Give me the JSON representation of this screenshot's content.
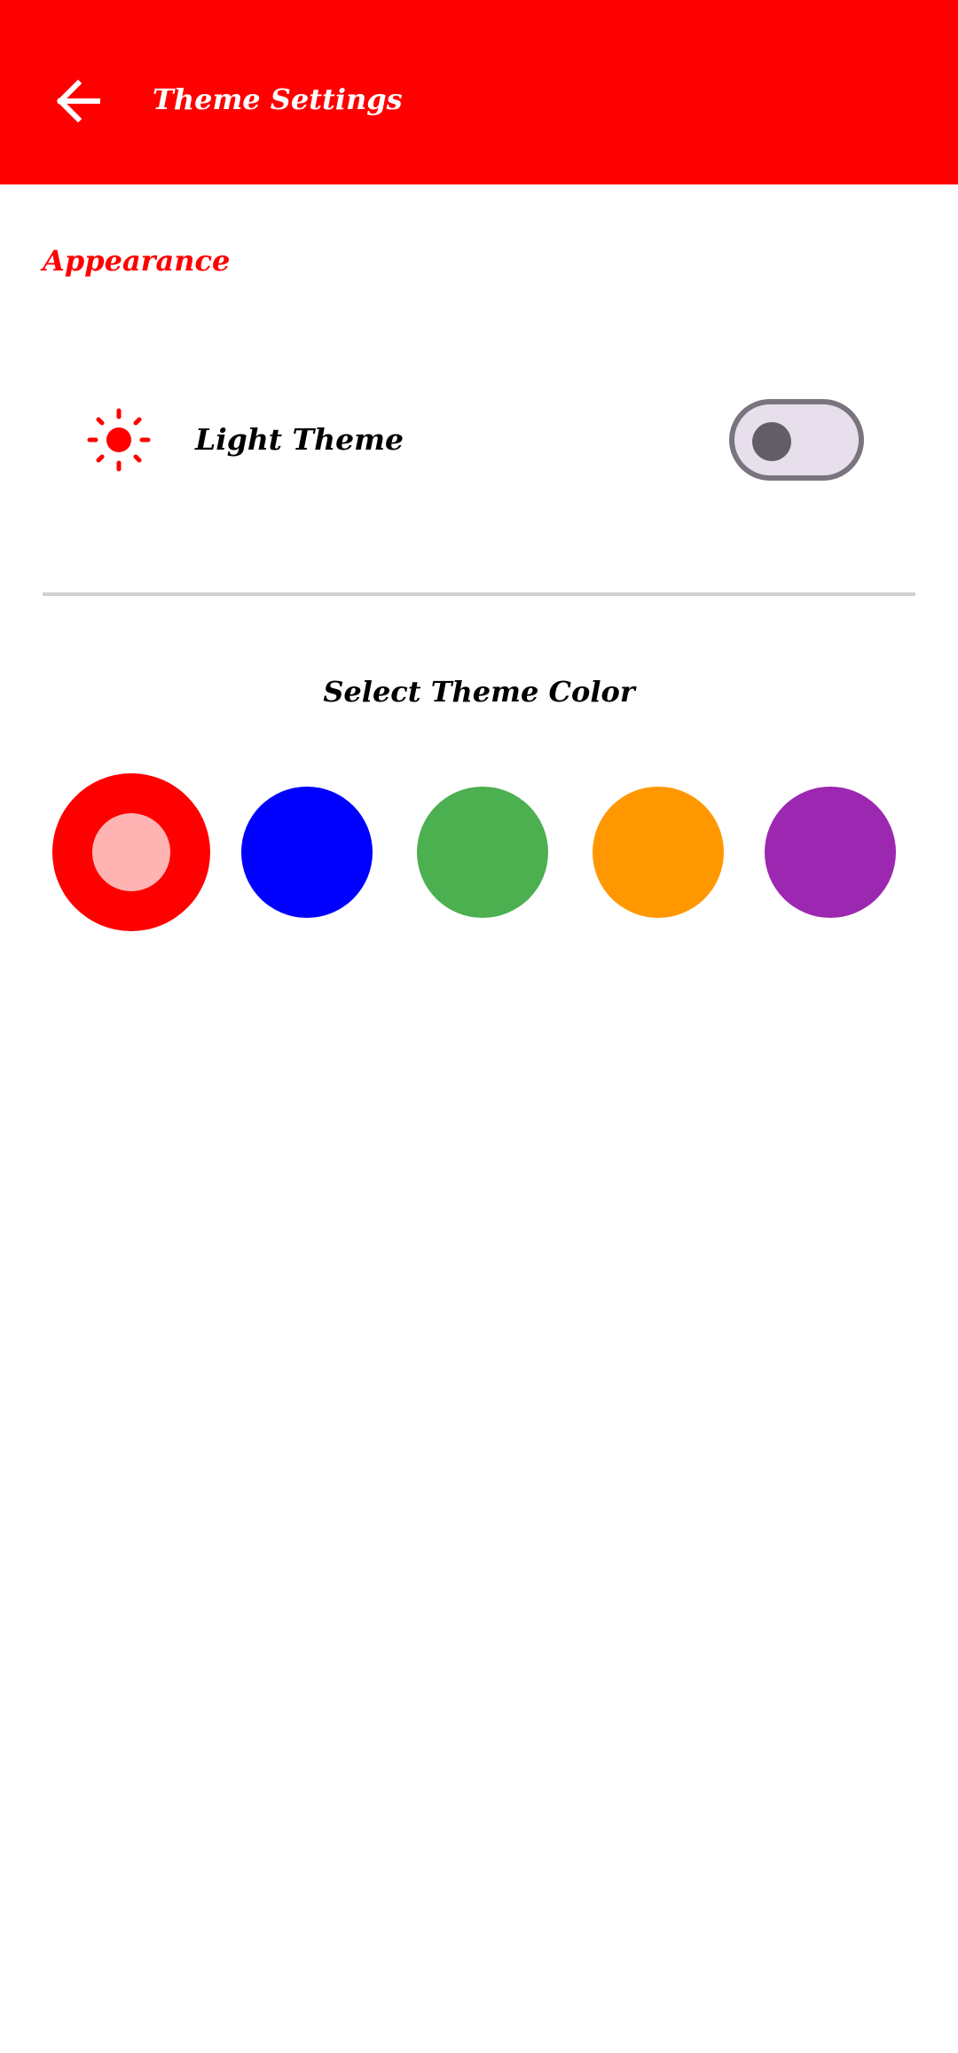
{
  "app_bar": {
    "title": "Theme Settings",
    "back_icon": "arrow-left-icon",
    "background": "#ff0000"
  },
  "appearance": {
    "section_title": "Appearance",
    "theme_row": {
      "icon": "sun-icon",
      "label": "Light Theme",
      "toggle_on": false
    }
  },
  "theme_colors": {
    "heading": "Select Theme Color",
    "swatches": [
      {
        "name": "red",
        "color": "#ff0000",
        "selected": true
      },
      {
        "name": "blue",
        "color": "#0000ff",
        "selected": false
      },
      {
        "name": "green",
        "color": "#4caf50",
        "selected": false
      },
      {
        "name": "orange",
        "color": "#ff9800",
        "selected": false
      },
      {
        "name": "purple",
        "color": "#9c27b0",
        "selected": false
      }
    ]
  },
  "colors": {
    "accent": "#ff0000",
    "toggle_track": "#e7e0ec",
    "toggle_outline": "#79747e",
    "toggle_thumb": "#625e66",
    "divider": "#d0d0d0"
  }
}
